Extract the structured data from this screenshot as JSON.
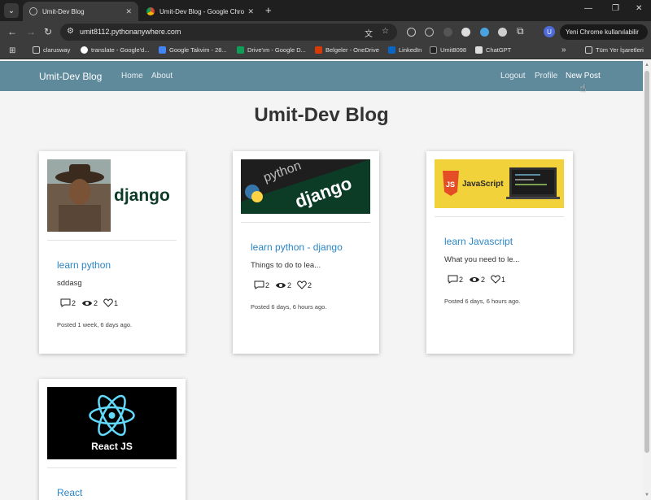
{
  "browser": {
    "tabs": [
      {
        "title": "Umit-Dev Blog",
        "active": true
      },
      {
        "title": "Umit-Dev Blog - Google Chrome",
        "active": false
      }
    ],
    "url": "umit8112.pythonanywhere.com",
    "update_button": "Yeni Chrome kullanılabilir",
    "profile_initial": "U",
    "bookmarks": [
      "clarusway",
      "translate - Google'd...",
      "Google Takvim - 28...",
      "Drive'ım - Google D...",
      "Belgeler - OneDrive",
      "LinkedIn",
      "Umit8098",
      "ChatGPT"
    ],
    "all_bookmarks": "Tüm Yer İşaretleri"
  },
  "navbar": {
    "brand": "Umit-Dev Blog",
    "links": [
      "Home",
      "About"
    ],
    "right_links": [
      "Logout",
      "Profile",
      "New Post"
    ],
    "color": "#5f8a9c"
  },
  "page": {
    "title": "Umit-Dev Blog"
  },
  "posts": [
    {
      "title": "learn python",
      "excerpt": "sddasg",
      "comments": "2",
      "views": "2",
      "likes": "1",
      "posted": "Posted 1 week, 6 days ago.",
      "image": "django-portrait"
    },
    {
      "title": "learn python - django",
      "excerpt": "Things to do to lea...",
      "comments": "2",
      "views": "2",
      "likes": "2",
      "posted": "Posted 6 days, 6 hours ago.",
      "image": "python-django"
    },
    {
      "title": "learn Javascript",
      "excerpt": "What you need to le...",
      "comments": "2",
      "views": "2",
      "likes": "1",
      "posted": "Posted 6 days, 6 hours ago.",
      "image": "javascript"
    },
    {
      "title": "React",
      "excerpt": "",
      "comments": "",
      "views": "",
      "likes": "",
      "posted": "",
      "image": "react-js"
    }
  ],
  "images": {
    "django_text": "django",
    "python_text": "python",
    "js_badge": "JS",
    "js_text": "JavaScript",
    "react_text": "React JS"
  },
  "colors": {
    "link": "#2b86c5",
    "page_bg": "#f4f4f4"
  }
}
